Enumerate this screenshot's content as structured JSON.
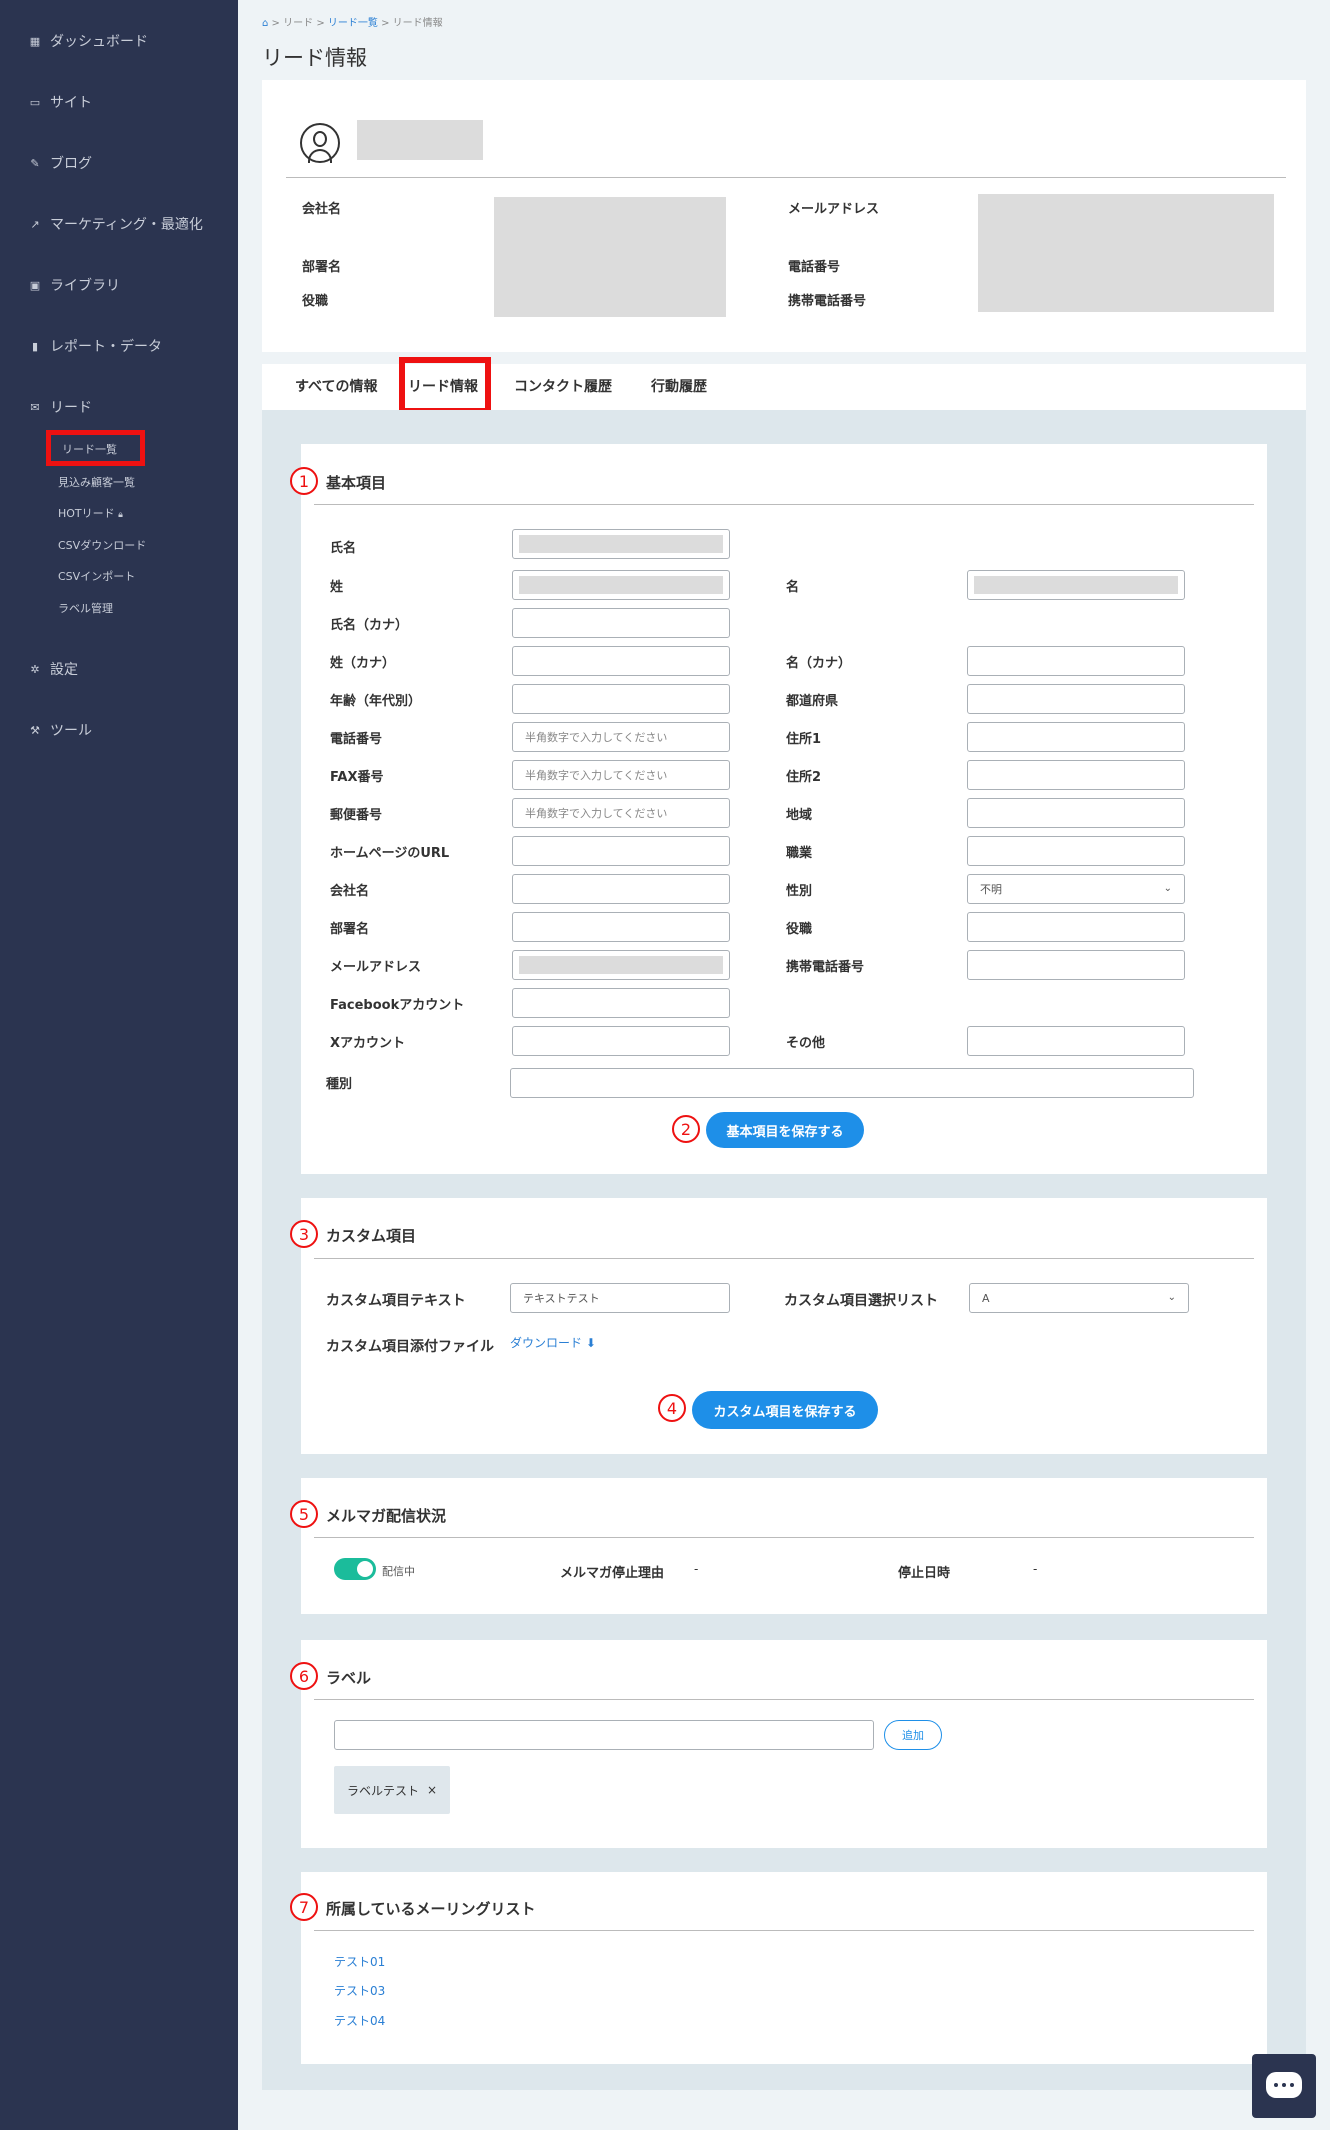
{
  "sidebar": {
    "items": [
      {
        "icon": "dashboard-icon",
        "label": "ダッシュボード"
      },
      {
        "icon": "site-icon",
        "label": "サイト"
      },
      {
        "icon": "pencil-icon",
        "label": "ブログ"
      },
      {
        "icon": "trend-icon",
        "label": "マーケティング・最適化"
      },
      {
        "icon": "image-icon",
        "label": "ライブラリ"
      },
      {
        "icon": "bar-chart-icon",
        "label": "レポート・データ"
      },
      {
        "icon": "mail-icon",
        "label": "リード"
      }
    ],
    "sub_items": [
      "リード一覧",
      "見込み顧客一覧",
      "HOTリード",
      "CSVダウンロード",
      "CSVインポート",
      "ラベル管理"
    ],
    "bottom_items": [
      {
        "icon": "gear-icon",
        "label": "設定"
      },
      {
        "icon": "wrench-icon",
        "label": "ツール"
      }
    ]
  },
  "breadcrumb": {
    "home": "⌂",
    "l1": "リード",
    "l2": "リード一覧",
    "l3": "リード情報",
    "sep": ">"
  },
  "page_title": "リード情報",
  "profile": {
    "company_label": "会社名",
    "email_label": "メールアドレス",
    "dept_label": "部署名",
    "phone_label": "電話番号",
    "position_label": "役職",
    "mobile_label": "携帯電話番号"
  },
  "tabs": [
    "すべての情報",
    "リード情報",
    "コンタクト履歴",
    "行動履歴"
  ],
  "basic": {
    "num": "1",
    "title": "基本項目",
    "labels": {
      "full_name": "氏名",
      "last_name": "姓",
      "first_name": "名",
      "full_kana": "氏名（カナ）",
      "last_kana": "姓（カナ）",
      "first_kana": "名（カナ）",
      "age": "年齢（年代別）",
      "prefecture": "都道府県",
      "phone": "電話番号",
      "addr1": "住所1",
      "fax": "FAX番号",
      "addr2": "住所2",
      "zip": "郵便番号",
      "region": "地域",
      "homepage": "ホームページのURL",
      "job": "職業",
      "company": "会社名",
      "gender": "性別",
      "dept": "部署名",
      "position": "役職",
      "email": "メールアドレス",
      "mobile": "携帯電話番号",
      "facebook": "Facebookアカウント",
      "x": "Xアカウント",
      "other": "その他",
      "type": "種別"
    },
    "placeholder_digits": "半角数字で入力してください",
    "gender_value": "不明",
    "save_num": "2",
    "save_label": "基本項目を保存する"
  },
  "custom": {
    "num": "3",
    "title": "カスタム項目",
    "text_label": "カスタム項目テキスト",
    "text_value": "テキストテスト",
    "select_label": "カスタム項目選択リスト",
    "select_value": "A",
    "file_label": "カスタム項目添付ファイル",
    "download_label": "ダウンロード",
    "save_num": "4",
    "save_label": "カスタム項目を保存する"
  },
  "mailmag": {
    "num": "5",
    "title": "メルマガ配信状況",
    "toggle_label": "配信中",
    "reason_label": "メルマガ停止理由",
    "reason_value": "-",
    "stop_label": "停止日時",
    "stop_value": "-"
  },
  "label": {
    "num": "6",
    "title": "ラベル",
    "add_label": "追加",
    "tag": "ラベルテスト",
    "tag_close": "×"
  },
  "mailing": {
    "num": "7",
    "title": "所属しているメーリングリスト",
    "items": [
      "テスト01",
      "テスト03",
      "テスト04"
    ]
  },
  "colors": {
    "sidebar": "#2b3450",
    "accent": "#1e8fe8",
    "highlight": "#ee1111",
    "toggle": "#1bbc9b"
  }
}
